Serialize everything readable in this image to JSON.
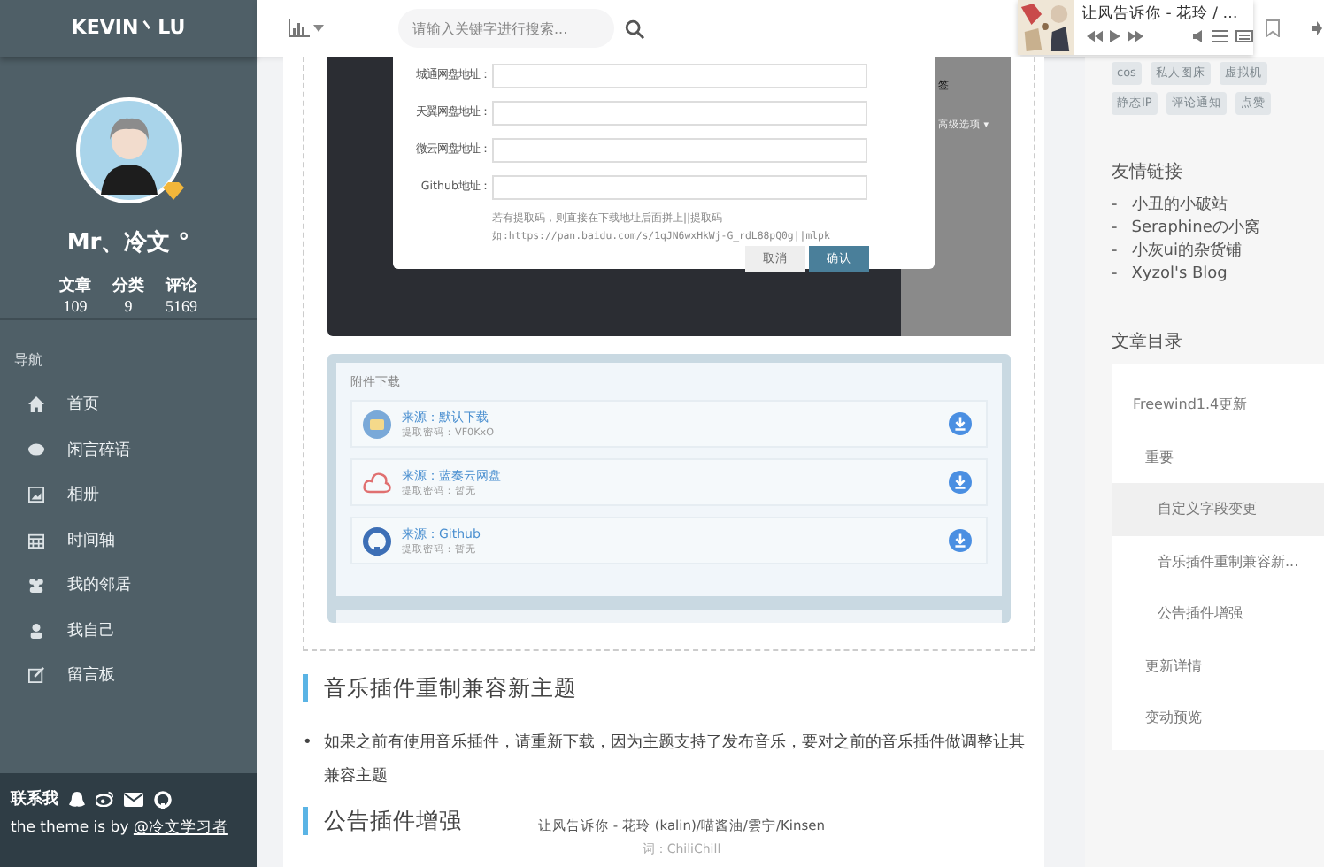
{
  "sidebar": {
    "logo": "KEVIN丶LU",
    "profile": {
      "name": "Mr、冷文 °",
      "stats": [
        {
          "label": "文章",
          "value": "109"
        },
        {
          "label": "分类",
          "value": "9"
        },
        {
          "label": "评论",
          "value": "5169"
        }
      ]
    },
    "nav_label": "导航",
    "nav_items": [
      {
        "label": "首页"
      },
      {
        "label": "闲言碎语"
      },
      {
        "label": "相册"
      },
      {
        "label": "时间轴"
      },
      {
        "label": "我的邻居"
      },
      {
        "label": "我自己"
      },
      {
        "label": "留言板"
      }
    ],
    "footer": {
      "contact_label": "联系我",
      "credit_prefix": "the theme is by",
      "credit_link": "@冷文学习者"
    }
  },
  "topbar": {
    "search": {
      "placeholder": "请输入关键字进行搜索..."
    }
  },
  "player": {
    "title": "让风告诉你 - 花玲 / …"
  },
  "article": {
    "screenshot": {
      "side_texts": [
        "签",
        "高级选项 ▾"
      ],
      "dialog": {
        "fields": [
          {
            "label": "城通网盘地址："
          },
          {
            "label": "天翼网盘地址："
          },
          {
            "label": "微云网盘地址："
          },
          {
            "label": "Github地址："
          }
        ],
        "hint": [
          "若有提取码，则直接在下载地址后面拼上||提取码",
          "如:https://pan.baidu.com/s/1qJN6wxHkWj-G_rdL88pQ0g||mlpk"
        ],
        "buttons": [
          {
            "label": "取消",
            "kind": "secondary"
          },
          {
            "label": "确认",
            "kind": "primary"
          }
        ]
      }
    },
    "downloads": {
      "title": "附件下载",
      "items": [
        {
          "source": "来源：默认下载",
          "code": "提取密码：VF0KxO"
        },
        {
          "source": "来源：蓝奏云网盘",
          "code": "提取密码：暂无"
        },
        {
          "source": "来源：Github",
          "code": "提取密码：暂无"
        }
      ]
    },
    "heading_1": "音乐插件重制兼容新主题",
    "bullets": [
      {
        "marker": "•",
        "text": "如果之前有使用音乐插件，请重新下载，因为主题支持了发布音乐，要对之前的音乐插件做调整让其兼容主题"
      }
    ],
    "heading_2": "公告插件增强"
  },
  "lyrics": [
    "让风告诉你 - 花玲 (kalin)/喵酱油/雲宁/Kinsen",
    "词：ChiliChill"
  ],
  "right": {
    "tags": [
      {
        "label": "cos"
      },
      {
        "label": "私人图床"
      },
      {
        "label": "虚拟机"
      },
      {
        "label": "静态IP"
      },
      {
        "label": "评论通知"
      },
      {
        "label": "点赞"
      }
    ],
    "links_title": "友情链接",
    "links": [
      {
        "marker": "-",
        "label": "小丑的小破站"
      },
      {
        "marker": "-",
        "label": "Seraphineの小窝"
      },
      {
        "marker": "-",
        "label": "小灰ui的杂货铺"
      },
      {
        "marker": "-",
        "label": "Xyzol's Blog"
      }
    ],
    "toc_title": "文章目录",
    "toc": [
      {
        "label": "Freewind1.4更新",
        "selected": false,
        "children": [
          {
            "label": "重要",
            "selected": false,
            "children": [
              {
                "label": "自定义字段变更",
                "selected": true
              },
              {
                "label": "音乐插件重制兼容新...",
                "selected": false
              },
              {
                "label": "公告插件增强",
                "selected": false
              }
            ]
          },
          {
            "label": "更新详情",
            "selected": false
          },
          {
            "label": "变动预览",
            "selected": false
          }
        ]
      }
    ]
  }
}
